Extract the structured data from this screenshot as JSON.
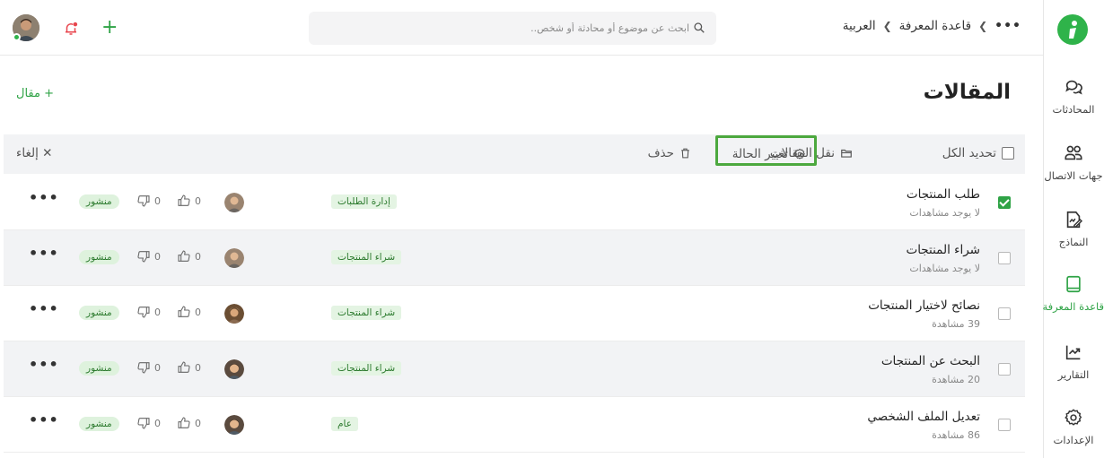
{
  "breadcrumb": {
    "more": "•••",
    "items": [
      "قاعدة المعرفة",
      "العربية"
    ]
  },
  "search": {
    "placeholder": "ابحث عن موضوع أو محادثة أو شخص.."
  },
  "sidebar": {
    "items": [
      {
        "label": "المحادثات",
        "icon": "chat-icon"
      },
      {
        "label": "جهات الاتصال",
        "icon": "contacts-icon"
      },
      {
        "label": "النماذج",
        "icon": "forms-icon"
      },
      {
        "label": "قاعدة المعرفة",
        "icon": "book-icon",
        "active": true
      },
      {
        "label": "التقارير",
        "icon": "reports-icon"
      },
      {
        "label": "الإعدادات",
        "icon": "gear-icon"
      }
    ]
  },
  "page": {
    "title": "المقالات",
    "add_label": "+ مقال"
  },
  "toolbar": {
    "select_all": "تحديد الكل",
    "move": "نقل المقالات",
    "change_status": "تغيير الحالة",
    "delete": "حذف",
    "cancel": "✕ إلغاء"
  },
  "articles": [
    {
      "title": "طلب المنتجات",
      "views": "لا يوجد مشاهدات",
      "category": "إدارة الطلبات",
      "likes": "0",
      "dislikes": "0",
      "status": "منشور",
      "checked": true
    },
    {
      "title": "شراء المنتجات",
      "views": "لا يوجد مشاهدات",
      "category": "شراء المنتجات",
      "likes": "0",
      "dislikes": "0",
      "status": "منشور",
      "checked": false
    },
    {
      "title": "نصائح لاختيار المنتجات",
      "views": "39 مشاهدة",
      "category": "شراء المنتجات",
      "likes": "0",
      "dislikes": "0",
      "status": "منشور",
      "checked": false
    },
    {
      "title": "البحث عن المنتجات",
      "views": "20 مشاهدة",
      "category": "شراء المنتجات",
      "likes": "0",
      "dislikes": "0",
      "status": "منشور",
      "checked": false
    },
    {
      "title": "تعديل الملف الشخصي",
      "views": "86 مشاهدة",
      "category": "عام",
      "likes": "0",
      "dislikes": "0",
      "status": "منشور",
      "checked": false
    }
  ],
  "row_more": "•••",
  "colors": {
    "accent": "#2fa346",
    "highlight": "#4ca83e",
    "notify": "#e8454d"
  }
}
